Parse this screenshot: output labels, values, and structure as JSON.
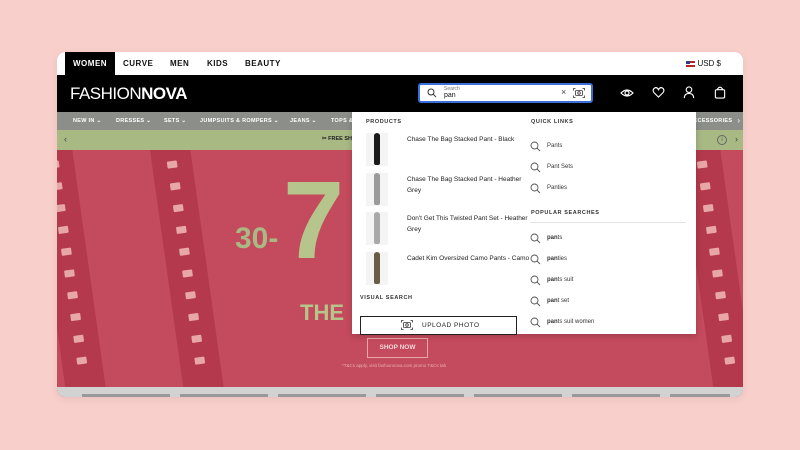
{
  "topbar": {
    "categories": [
      "WOMEN",
      "CURVE",
      "MEN",
      "KIDS",
      "BEAUTY"
    ],
    "currency": "USD $"
  },
  "header": {
    "logo_light": "FASHION",
    "logo_bold": "NOVA",
    "search": {
      "placeholder": "Search",
      "value": "pan"
    },
    "icons": [
      "eye-icon",
      "heart-icon",
      "user-icon",
      "bag-icon"
    ]
  },
  "nav": {
    "items": [
      "NEW IN",
      "DRESSES",
      "SETS",
      "JUMPSUITS & ROMPERS",
      "JEANS",
      "TOPS &",
      "ACCESSORIES"
    ]
  },
  "promo": {
    "text": "FREE SH"
  },
  "hero": {
    "headline_top": "30-7",
    "headline_mid": "THE",
    "cta": "SHOP NOW",
    "disclaimer": "*T&Cs apply, visit fashionnova.com promo T&Cs tab"
  },
  "dropdown": {
    "products_heading": "PRODUCTS",
    "products": [
      {
        "name": "Chase The Bag Stacked Pant - Black",
        "color": "#1a1a1a"
      },
      {
        "name": "Chase The Bag Stacked Pant - Heather Grey",
        "color": "#9a9a9a"
      },
      {
        "name": "Don't Get This Twisted Pant Set - Heather Grey",
        "color": "#a9a9a9"
      },
      {
        "name": "Cadet Kim Oversized Camo Pants - Camo",
        "color": "#6b5e46"
      }
    ],
    "visual_search_heading": "VISUAL SEARCH",
    "upload_label": "UPLOAD PHOTO",
    "quick_links_heading": "QUICK LINKS",
    "quick_links": [
      "Pants",
      "Pant Sets",
      "Panties"
    ],
    "popular_heading": "POPULAR SEARCHES",
    "popular": [
      {
        "match": "pan",
        "rest": "ts"
      },
      {
        "match": "pan",
        "rest": "ties"
      },
      {
        "match": "pan",
        "rest": "ts suit"
      },
      {
        "match": "pan",
        "rest": "t set"
      },
      {
        "match": "pan",
        "rest": "ts suit women"
      }
    ]
  },
  "colors": {
    "accent_blue": "#3a6fd8",
    "hero_red": "#c44a5d",
    "hero_green": "#a8b984",
    "nav_grey": "#8c8e8a"
  }
}
